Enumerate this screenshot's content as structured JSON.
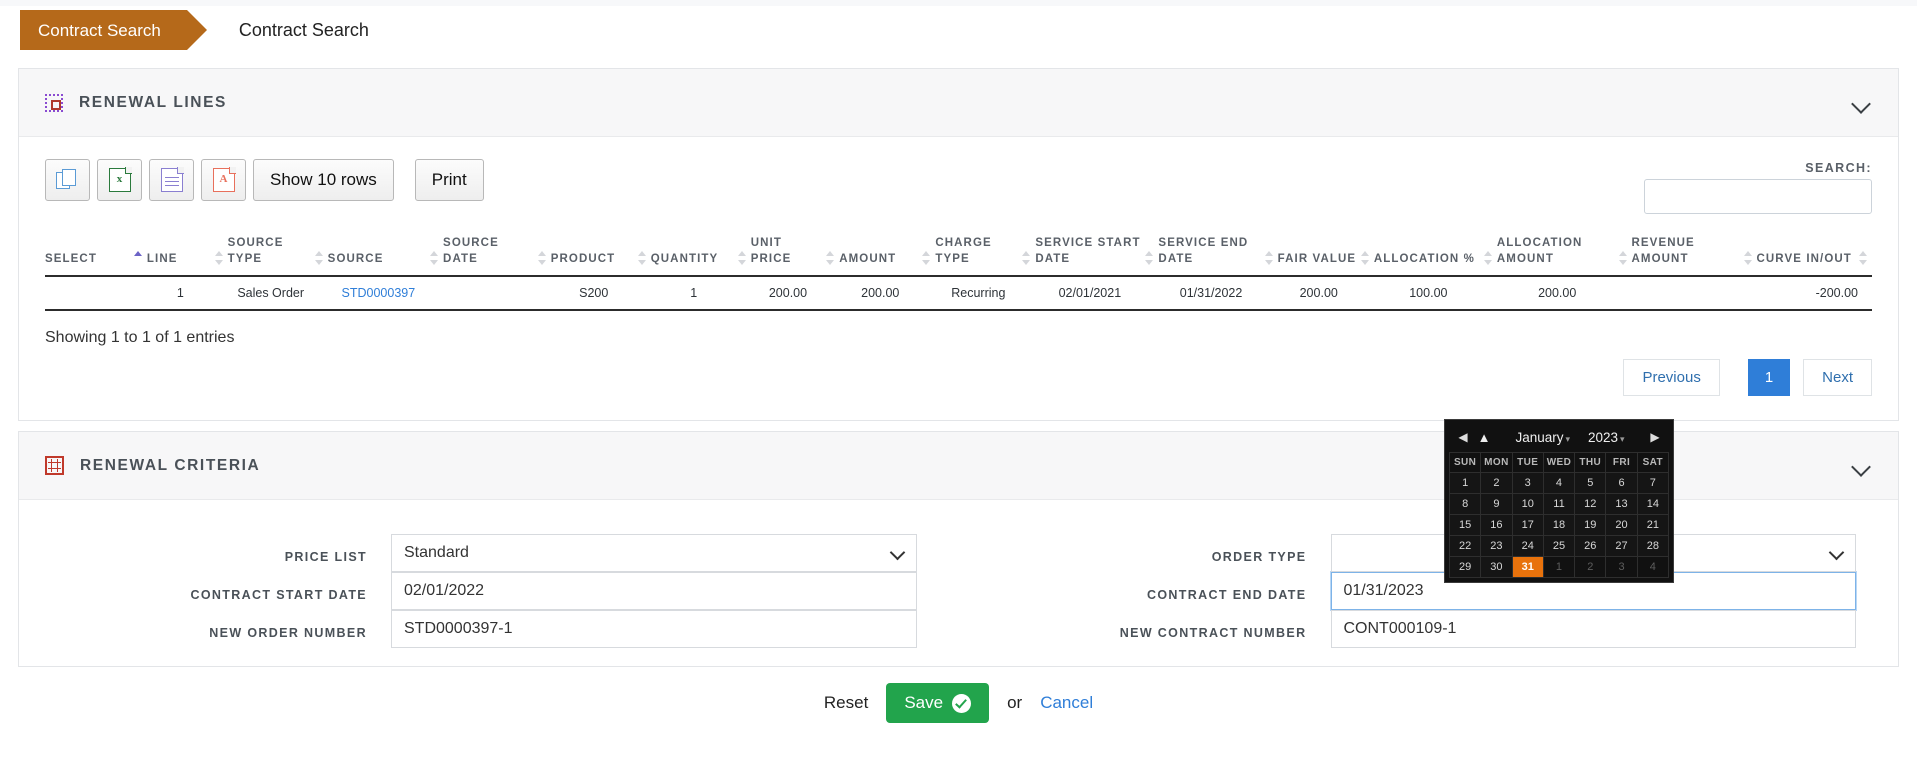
{
  "breadcrumb": {
    "tab_label": "Contract Search",
    "page_title": "Contract Search"
  },
  "renewal_lines": {
    "panel_title": "RENEWAL LINES",
    "panel_icon": "dotted-square-icon",
    "collapse_icon": "chevron-down-icon",
    "toolbar": {
      "copy_label": "",
      "excel_label": "",
      "csv_label": "",
      "pdf_label": "",
      "show_rows_label": "Show 10 rows",
      "print_label": "Print"
    },
    "search": {
      "label": "SEARCH:",
      "value": "",
      "placeholder": ""
    },
    "columns": [
      {
        "label": "SELECT",
        "sort": "asc"
      },
      {
        "label": "LINE",
        "sort": "none"
      },
      {
        "label": "SOURCE TYPE",
        "sort": "none"
      },
      {
        "label": "SOURCE",
        "sort": "none"
      },
      {
        "label": "SOURCE DATE",
        "sort": "none"
      },
      {
        "label": "PRODUCT",
        "sort": "none"
      },
      {
        "label": "QUANTITY",
        "sort": "none"
      },
      {
        "label": "UNIT PRICE",
        "sort": "none"
      },
      {
        "label": "AMOUNT",
        "sort": "none"
      },
      {
        "label": "CHARGE TYPE",
        "sort": "none"
      },
      {
        "label": "SERVICE START DATE",
        "sort": "none"
      },
      {
        "label": "SERVICE END DATE",
        "sort": "none"
      },
      {
        "label": "FAIR VALUE",
        "sort": "none"
      },
      {
        "label": "ALLOCATION %",
        "sort": "none"
      },
      {
        "label": "ALLOCATION AMOUNT",
        "sort": "none"
      },
      {
        "label": "REVENUE AMOUNT",
        "sort": "none"
      },
      {
        "label": "CURVE IN/OUT",
        "sort": "none"
      }
    ],
    "rows": [
      {
        "select": "",
        "line": "1",
        "source_type": "Sales Order",
        "source": "STD0000397",
        "source_date": "",
        "product": "S200",
        "quantity": "1",
        "unit_price": "200.00",
        "amount": "200.00",
        "charge_type": "Recurring",
        "service_start_date": "02/01/2021",
        "service_end_date": "01/31/2022",
        "fair_value": "200.00",
        "allocation_pct": "100.00",
        "allocation_amount": "200.00",
        "revenue_amount": "",
        "curve_in_out": "-200.00"
      }
    ],
    "showing_text": "Showing 1 to 1 of 1 entries",
    "pagination": {
      "previous_label": "Previous",
      "current_page": "1",
      "next_label": "Next"
    }
  },
  "renewal_criteria": {
    "panel_title": "RENEWAL CRITERIA",
    "panel_icon": "calendar-grid-icon",
    "collapse_icon": "chevron-down-icon",
    "left_fields": [
      {
        "label": "PRICE LIST",
        "value": "Standard",
        "type": "select"
      },
      {
        "label": "CONTRACT START DATE",
        "value": "02/01/2022",
        "type": "text"
      },
      {
        "label": "NEW ORDER NUMBER",
        "value": "STD0000397-1",
        "type": "text"
      }
    ],
    "right_fields": [
      {
        "label": "ORDER TYPE",
        "value": "",
        "type": "select"
      },
      {
        "label": "CONTRACT END DATE",
        "value": "01/31/2023",
        "type": "text"
      },
      {
        "label": "NEW CONTRACT NUMBER",
        "value": "CONT000109-1",
        "type": "text"
      }
    ]
  },
  "datepicker": {
    "prev_icon": "left-arrow-icon",
    "home_icon": "home-icon",
    "next_icon": "right-arrow-icon",
    "month": "January",
    "year": "2023",
    "weekdays": [
      "SUN",
      "MON",
      "TUE",
      "WED",
      "THU",
      "FRI",
      "SAT"
    ],
    "weeks": [
      [
        {
          "d": "1",
          "o": false
        },
        {
          "d": "2",
          "o": false
        },
        {
          "d": "3",
          "o": false
        },
        {
          "d": "4",
          "o": false
        },
        {
          "d": "5",
          "o": false
        },
        {
          "d": "6",
          "o": false
        },
        {
          "d": "7",
          "o": false
        }
      ],
      [
        {
          "d": "8",
          "o": false
        },
        {
          "d": "9",
          "o": false
        },
        {
          "d": "10",
          "o": false
        },
        {
          "d": "11",
          "o": false
        },
        {
          "d": "12",
          "o": false
        },
        {
          "d": "13",
          "o": false
        },
        {
          "d": "14",
          "o": false
        }
      ],
      [
        {
          "d": "15",
          "o": false
        },
        {
          "d": "16",
          "o": false
        },
        {
          "d": "17",
          "o": false
        },
        {
          "d": "18",
          "o": false
        },
        {
          "d": "19",
          "o": false
        },
        {
          "d": "20",
          "o": false
        },
        {
          "d": "21",
          "o": false
        }
      ],
      [
        {
          "d": "22",
          "o": false
        },
        {
          "d": "23",
          "o": false
        },
        {
          "d": "24",
          "o": false
        },
        {
          "d": "25",
          "o": false
        },
        {
          "d": "26",
          "o": false
        },
        {
          "d": "27",
          "o": false
        },
        {
          "d": "28",
          "o": false
        }
      ],
      [
        {
          "d": "29",
          "o": false
        },
        {
          "d": "30",
          "o": false
        },
        {
          "d": "31",
          "o": false,
          "sel": true
        },
        {
          "d": "1",
          "o": true
        },
        {
          "d": "2",
          "o": true
        },
        {
          "d": "3",
          "o": true
        },
        {
          "d": "4",
          "o": true
        }
      ]
    ],
    "selected_day": "31"
  },
  "footer": {
    "reset_label": "Reset",
    "save_label": "Save",
    "save_icon": "check-circle-icon",
    "or_label": "or",
    "cancel_label": "Cancel"
  },
  "colors": {
    "breadcrumb_tab": "#b5691a",
    "link": "#2f7ed8",
    "save_green": "#22a44c",
    "datepicker_selected": "#e8720c",
    "page_active": "#2f7ed8"
  }
}
